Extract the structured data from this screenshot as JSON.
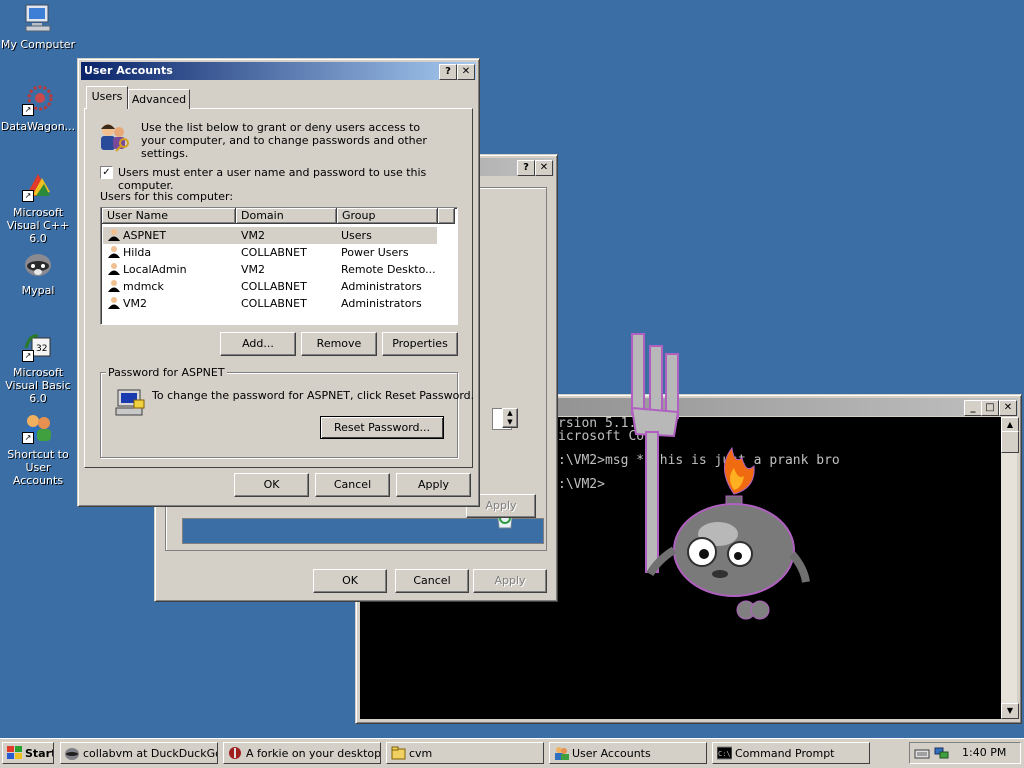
{
  "desktop": {
    "icons": [
      {
        "label": "My Computer"
      },
      {
        "label": "DataWagon..."
      },
      {
        "label": "Microsoft Visual C++ 6.0"
      },
      {
        "label": "Mypal"
      },
      {
        "label": "Microsoft Visual Basic 6.0"
      },
      {
        "label": "Shortcut to User Accounts"
      }
    ]
  },
  "background_dialog": {
    "help_glyph": "?",
    "close_glyph": "✕",
    "ok_label": "OK",
    "cancel_label": "Cancel",
    "apply_label": "Apply",
    "apply_label_inner": "Apply"
  },
  "user_accounts": {
    "title": "User Accounts",
    "help_glyph": "?",
    "close_glyph": "✕",
    "tabs": [
      "Users",
      "Advanced"
    ],
    "intro_text": "Use the list below to grant or deny users access to your computer, and to change passwords and other settings.",
    "require_password_label": "Users must enter a user name and password to use this computer.",
    "require_password_checked": true,
    "users_label": "Users for this computer:",
    "columns": [
      "User Name",
      "Domain",
      "Group"
    ],
    "users": [
      {
        "name": "ASPNET",
        "domain": "VM2",
        "group": "Users"
      },
      {
        "name": "Hilda",
        "domain": "COLLABNET",
        "group": "Power Users"
      },
      {
        "name": "LocalAdmin",
        "domain": "VM2",
        "group": "Remote Deskto..."
      },
      {
        "name": "mdmck",
        "domain": "COLLABNET",
        "group": "Administrators"
      },
      {
        "name": "VM2",
        "domain": "COLLABNET",
        "group": "Administrators"
      }
    ],
    "add_label": "Add...",
    "remove_label": "Remove",
    "properties_label": "Properties",
    "password_group_label": "Password for ASPNET",
    "password_text": "To change the password for ASPNET, click Reset Password.",
    "reset_password_label": "Reset Password...",
    "ok_label": "OK",
    "cancel_label": "Cancel",
    "apply_label": "Apply"
  },
  "console": {
    "min_glyph": "_",
    "max_glyph": "□",
    "close_glyph": "✕",
    "lines": [
      "rsion 5.1.26",
      "icrosoft Co",
      ":\\VM2>msg * this is just a prank bro",
      "",
      ":\\VM2>"
    ]
  },
  "taskbar": {
    "start_label": "Start",
    "items": [
      {
        "label": "collabvm at DuckDuckGo ..."
      },
      {
        "label": "A forkie on your desktop"
      },
      {
        "label": "cvm"
      },
      {
        "label": "User Accounts"
      },
      {
        "label": "Command Prompt"
      }
    ],
    "clock": "1:40 PM"
  },
  "colors": {
    "desktop": "#3a6ea5",
    "titlebar_active": "#0a246a",
    "face": "#d4d0c8"
  }
}
